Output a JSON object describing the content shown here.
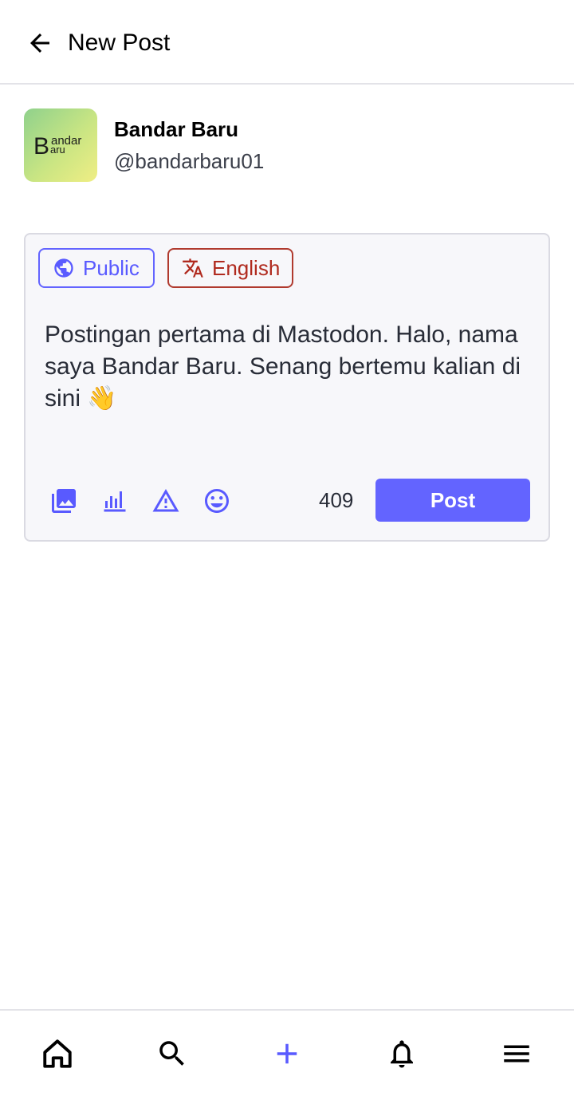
{
  "header": {
    "title": "New Post",
    "back_icon": "arrow-left-icon"
  },
  "account": {
    "display_name": "Bandar Baru",
    "handle": "@bandarbaru01",
    "avatar_text_big": "B",
    "avatar_text_top": "andar",
    "avatar_text_bottom": "aru"
  },
  "compose": {
    "visibility_label": "Public",
    "visibility_icon": "globe-icon",
    "language_label": "English",
    "language_icon": "translate-icon",
    "text": "Postingan pertama di Mastodon. Halo, nama saya Bandar Baru. Senang bertemu kalian di sini 👋",
    "tools": [
      "media-icon",
      "poll-icon",
      "content-warning-icon",
      "emoji-icon"
    ],
    "char_counter": "409",
    "post_label": "Post"
  },
  "bottom_nav": {
    "items": [
      "home-icon",
      "search-icon",
      "compose-plus-icon",
      "notifications-bell-icon",
      "menu-icon"
    ]
  },
  "colors": {
    "accent": "#6364ff",
    "language_chip": "#b03a2e",
    "border": "#dadae2",
    "compose_bg": "#f7f7fa"
  }
}
